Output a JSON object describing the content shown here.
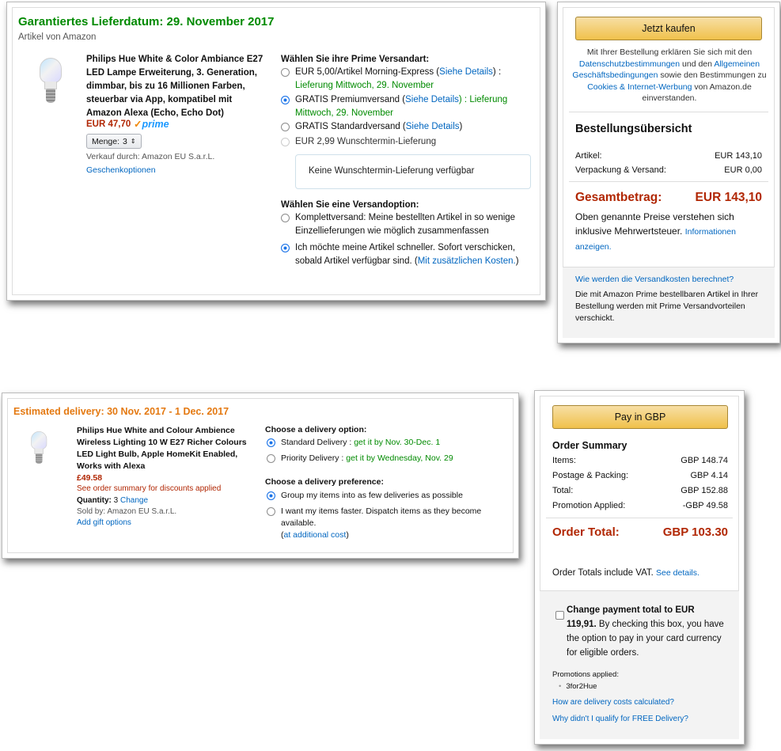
{
  "de_shipment": {
    "header": "Garantiertes Lieferdatum: 29. November 2017",
    "subheader": "Artikel von Amazon",
    "product_title": "Philips Hue White & Color Ambiance E27 LED Lampe Erweiterung, 3. Generation, dimmbar, bis zu 16 Millionen Farben, steuerbar via App, kompatibel mit Amazon Alexa (Echo, Echo Dot)",
    "price": "EUR 47,70",
    "prime_check": "✓",
    "prime_label": "prime",
    "quantity_label": "Menge:",
    "quantity_value": "3",
    "seller": "Verkauf durch: Amazon EU S.a.r.L.",
    "gift_options": "Geschenkoptionen",
    "shipping_title": "Wählen Sie ihre Prime Versandart:",
    "options": [
      {
        "text": "EUR 5,00/Artikel Morning-Express (",
        "link": "Siehe Details",
        "after": ") :",
        "delivery": "Lieferung Mittwoch, 29. November",
        "selected": false
      },
      {
        "text": "GRATIS Premiumversand (",
        "link": "Siehe Details",
        "after": ") :",
        "delivery": "Lieferung Mittwoch, 29. November",
        "selected": true
      },
      {
        "text": "GRATIS Standardversand  (",
        "link": "Siehe Details",
        "after": ")",
        "selected": false
      },
      {
        "text": "EUR 2,99 Wunschtermin-Lieferung",
        "selected": false,
        "disabled": true
      }
    ],
    "no_date_box": "Keine Wunschtermin-Lieferung verfügbar",
    "ship_option_title": "Wählen Sie eine Versandoption:",
    "ship_opt1": "Komplettversand: Meine bestellten Artikel in so wenige Einzellieferungen wie möglich zusammenfassen",
    "ship_opt2_text": "Ich möchte meine Artikel schneller. Sofort verschicken, sobald Artikel verfügbar sind. (",
    "ship_opt2_link": "Mit zusätzlichen Kosten.",
    "ship_opt2_after": ")"
  },
  "de_summary": {
    "buy_button": "Jetzt kaufen",
    "agree_1": "Mit Ihrer Bestellung erklären Sie sich mit den",
    "agree_link1": "Datenschutzbestimmungen",
    "agree_2": " und den ",
    "agree_link2": "Allgemeinen Geschäftsbedingungen",
    "agree_3": " sowie den Bestimmungen zu ",
    "agree_link3": "Cookies & Internet-Werbung",
    "agree_4": " von Amazon.de einverstanden.",
    "title": "Bestellungsübersicht",
    "items_label": "Artikel:",
    "items_value": "EUR 143,10",
    "shipping_label": "Verpackung & Versand:",
    "shipping_value": "EUR 0,00",
    "total_label": "Gesamtbetrag:",
    "total_value": "EUR 143,10",
    "vat_text": "Oben genannte Preise verstehen sich inklusive Mehrwertsteuer. ",
    "vat_link": "Informationen anzeigen.",
    "how_link": "Wie werden die Versandkosten berechnet?",
    "prime_note": "Die mit Amazon Prime bestellbaren Artikel in Ihrer Bestellung werden mit Prime Versandvorteilen verschickt."
  },
  "uk_shipment": {
    "header": "Estimated delivery:  30 Nov. 2017 - 1 Dec. 2017",
    "product_title": "Philips Hue White and Colour Ambience Wireless Lighting 10 W E27 Richer Colours LED Light Bulb, Apple HomeKit Enabled, Works with Alexa",
    "price": "£49.58",
    "discount_note": "See order summary for discounts applied",
    "quantity_label": "Quantity:",
    "quantity_value": " 3 ",
    "quantity_change": "Change",
    "seller": "Sold by: Amazon EU S.a.r.L.",
    "gift_options": "Add gift options",
    "delivery_title": "Choose a delivery option:",
    "opt1_text": "Standard Delivery : ",
    "opt1_date": "get it by Nov. 30-Dec. 1",
    "opt2_text": "Priority Delivery : ",
    "opt2_date": "get it by Wednesday, Nov. 29",
    "pref_title": "Choose a delivery preference:",
    "pref1": "Group my items into as few deliveries as possible",
    "pref2": "I want my items faster. Dispatch items as they become available.",
    "pref2_link": "at additional cost"
  },
  "uk_summary": {
    "pay_button": "Pay in GBP",
    "title": "Order Summary",
    "rows": [
      {
        "label": "Items:",
        "value": "GBP 148.74"
      },
      {
        "label": "Postage & Packing:",
        "value": "GBP 4.14"
      },
      {
        "label": "Total:",
        "value": "GBP 152.88"
      },
      {
        "label": "Promotion Applied:",
        "value": "-GBP 49.58"
      }
    ],
    "total_label": "Order Total:",
    "total_value": "GBP 103.30",
    "vat_text": "Order Totals include VAT. ",
    "vat_link": "See details.",
    "change_bold": "Change payment total to EUR 119,91.",
    "change_rest": " By checking this box, you have the option to pay in your card currency for eligible orders.",
    "promotions_label": "Promotions applied:",
    "promotion_item": "3for2Hue",
    "how_link": "How are delivery costs calculated?",
    "why_link": "Why didn't I qualify for FREE Delivery?"
  }
}
